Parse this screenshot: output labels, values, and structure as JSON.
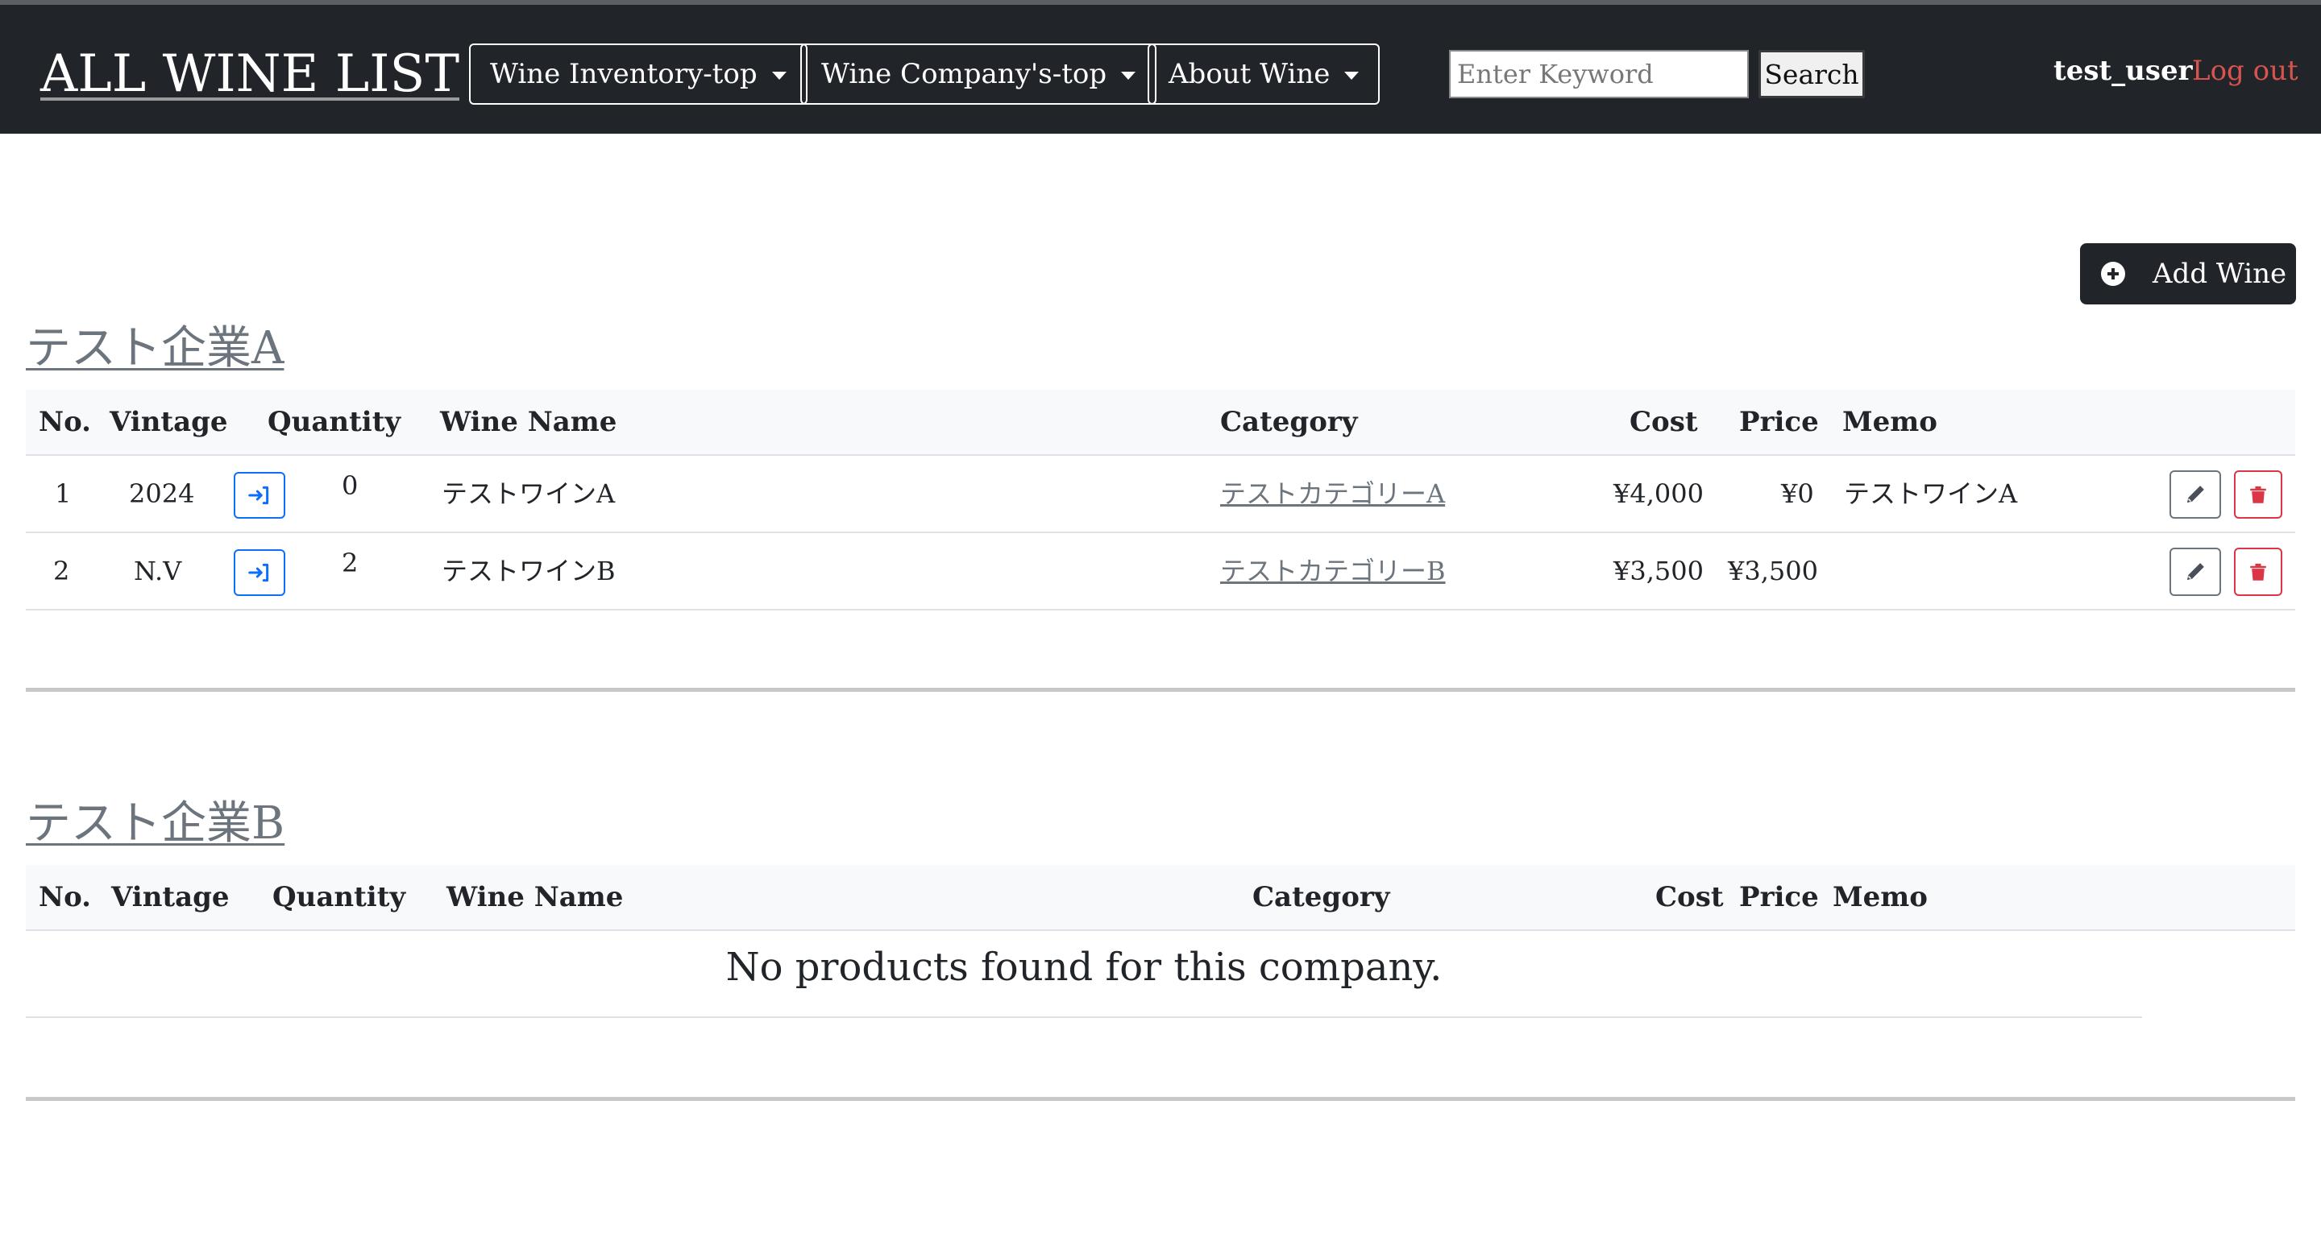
{
  "header": {
    "brand": "ALL WINE LIST",
    "nav": [
      {
        "label": "Wine Inventory-top"
      },
      {
        "label": "Wine Company's-top"
      },
      {
        "label": "About Wine"
      }
    ],
    "search": {
      "placeholder": "Enter Keyword",
      "value": "",
      "button_label": "Search"
    },
    "user": "test_user",
    "logout_label": "Log out"
  },
  "actions": {
    "add_wine_label": "Add Wine"
  },
  "table_headers": {
    "no": "No.",
    "vintage": "Vintage",
    "quantity": "Quantity",
    "wine_name": "Wine Name",
    "category": "Category",
    "cost": "Cost",
    "price": "Price",
    "memo": "Memo"
  },
  "companies": [
    {
      "name": "テスト企業A",
      "wines": [
        {
          "no": "1",
          "vintage": "2024",
          "quantity": "0",
          "name": "テストワインA",
          "category": "テストカテゴリーA",
          "cost": "¥4,000",
          "price": "¥0",
          "memo": "テストワインA"
        },
        {
          "no": "2",
          "vintage": "N.V",
          "quantity": "2",
          "name": "テストワインB",
          "category": "テストカテゴリーB",
          "cost": "¥3,500",
          "price": "¥3,500",
          "memo": ""
        }
      ]
    },
    {
      "name": "テスト企業B",
      "wines": [],
      "empty_message": "No products found for this company."
    }
  ],
  "colors": {
    "navbar": "#212529",
    "logout": "#d9534f",
    "stock_button": "#0d6efd",
    "delete_button": "#dc3545",
    "link_muted": "#6c757d"
  },
  "icons": {
    "stock": "box-arrow-in-right-icon",
    "edit": "pencil-icon",
    "delete": "trash-icon",
    "add": "plus-circle-icon",
    "dropdown": "caret-down-icon"
  }
}
